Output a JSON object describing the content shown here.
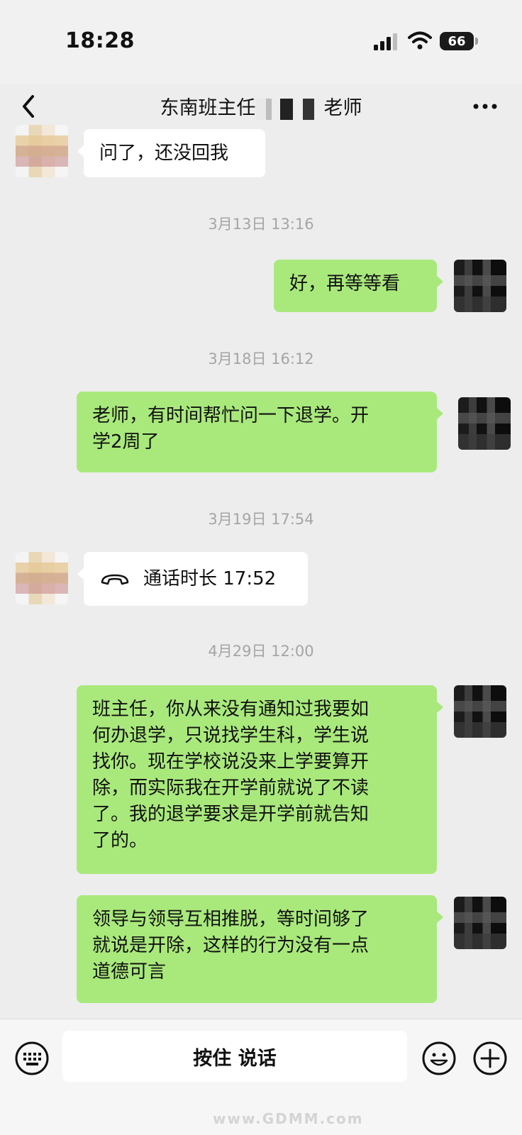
{
  "status_bar": {
    "time": "18:28",
    "battery": "66"
  },
  "nav": {
    "title_prefix": "东南班主任",
    "title_suffix": "老师"
  },
  "messages": [
    {
      "side": "in",
      "text": "问了，还没回我"
    },
    {
      "timestamp": "3月13日 13:16"
    },
    {
      "side": "out",
      "text": "好，再等等看"
    },
    {
      "timestamp": "3月18日 16:12"
    },
    {
      "side": "out",
      "lines": [
        "老师，有时间帮忙问一下退学。开",
        "学2周了"
      ]
    },
    {
      "timestamp": "3月19日 17:54"
    },
    {
      "side": "in",
      "type": "call",
      "text": "通话时长 17:52"
    },
    {
      "timestamp": "4月29日 12:00"
    },
    {
      "side": "out",
      "lines": [
        "班主任，你从来没有通知过我要如",
        "何办退学，只说找学生科，学生说",
        "找你。现在学校说没来上学要算开",
        "除，而实际我在开学前就说了不读",
        "了。我的退学要求是开学前就告知",
        "了的。"
      ]
    },
    {
      "side": "out",
      "lines": [
        "领导与领导互相推脱，等时间够了",
        "就说是开除，这样的行为没有一点",
        "道德可言"
      ]
    }
  ],
  "input_bar": {
    "hold_to_talk_label": "按住 说话"
  },
  "watermark": "www.GDMM.com",
  "colors": {
    "out_bubble": "#a9e97c",
    "in_bubble": "#ffffff",
    "background": "#ededed"
  }
}
